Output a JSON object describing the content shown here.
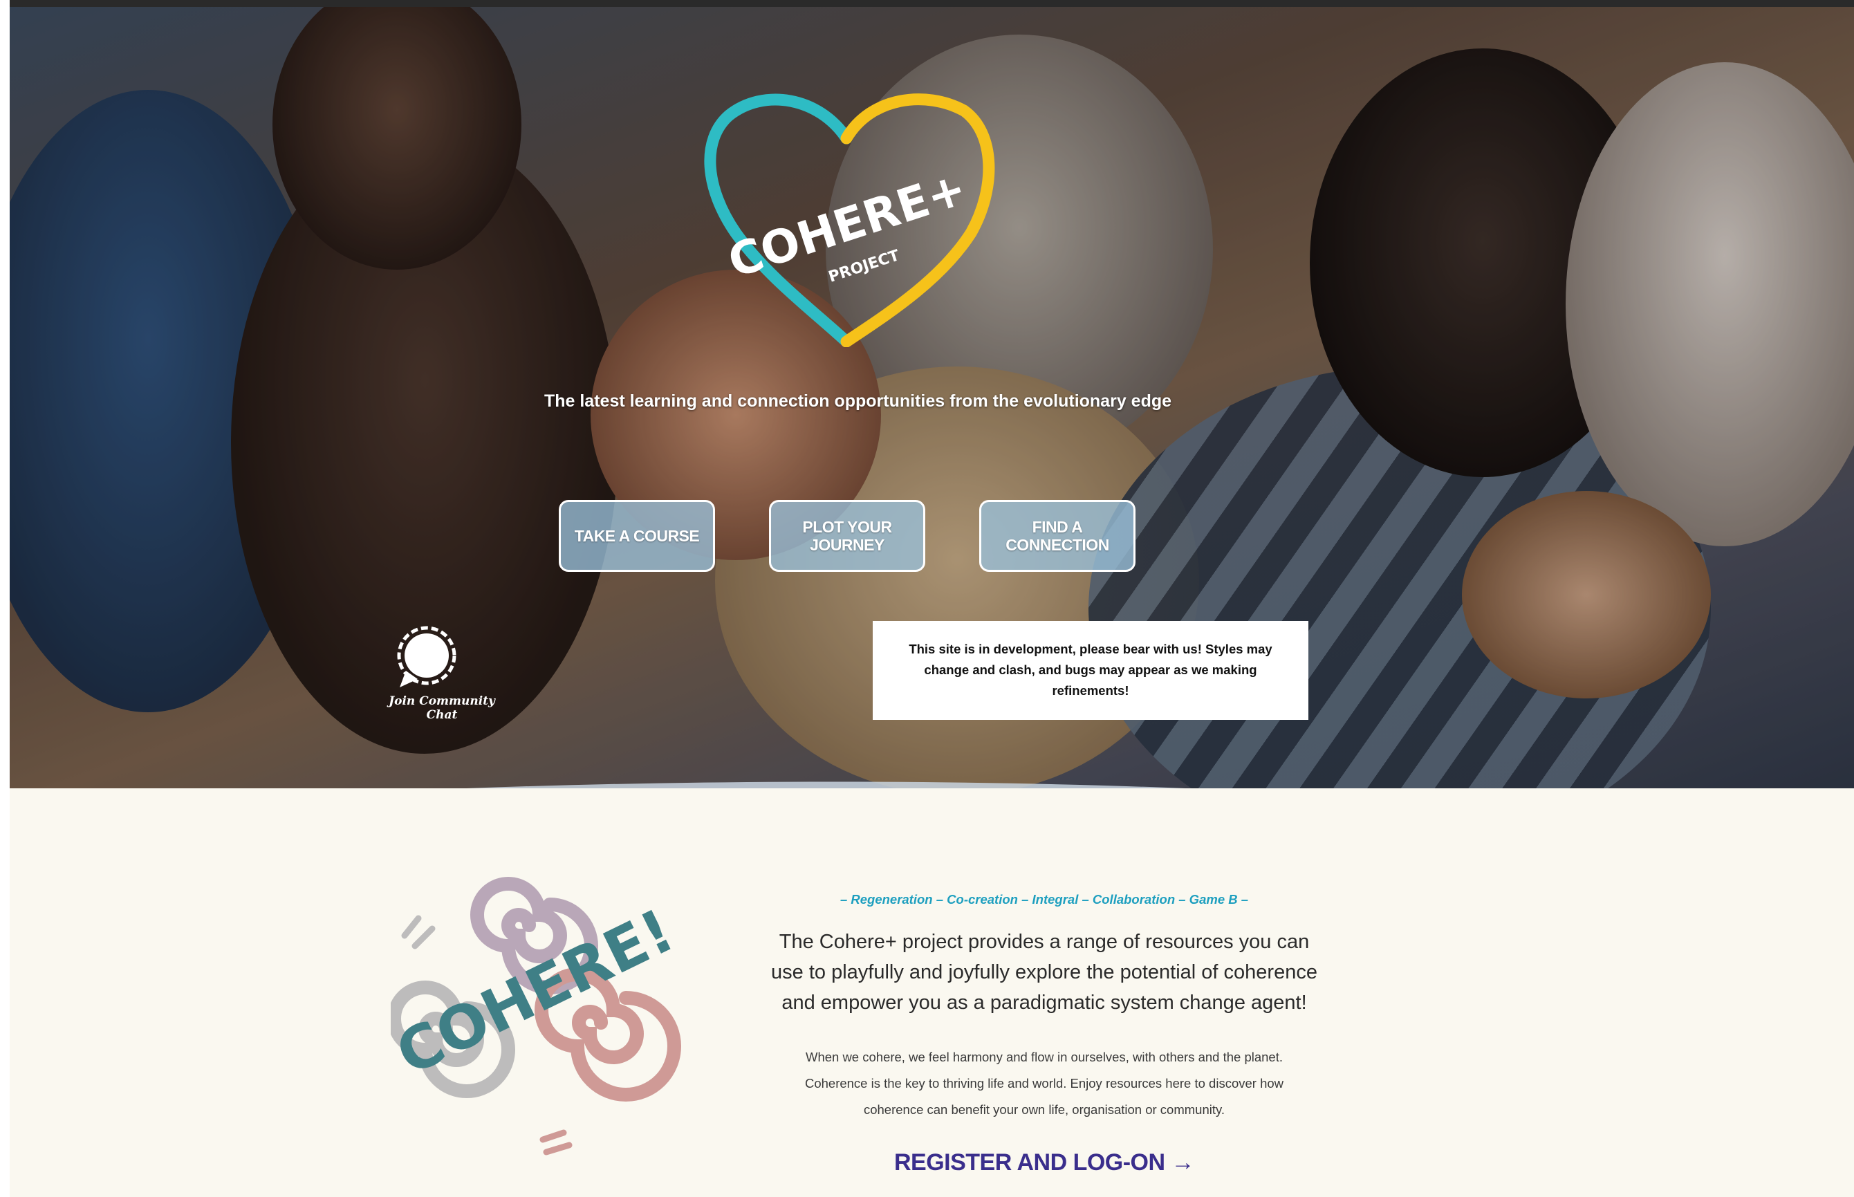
{
  "hero": {
    "logo": {
      "main": "COHERE+",
      "sub": "PROJECT",
      "heart_colors": [
        "#2ebcc4",
        "#f6c21a"
      ]
    },
    "tagline": "The latest learning and connection opportunities from the evolutionary edge",
    "buttons": [
      {
        "label": "TAKE A COURSE"
      },
      {
        "label": "PLOT YOUR JOURNEY"
      },
      {
        "label": "FIND A CONNECTION"
      }
    ],
    "chat": {
      "icon": "speech-bubble-icon",
      "label": "Join Community Chat"
    },
    "notice": "This site is in development, please bear with us!  Styles may change and clash, and bugs may appear as we making refinements!"
  },
  "intro": {
    "swirl_logo": {
      "text": "COHERE!",
      "colors": [
        "#3f7f86",
        "#b9a7b8",
        "#cf9a96",
        "#bdbcbc"
      ]
    },
    "values": "– Regeneration – Co-creation – Integral – Collaboration – Game B –",
    "lead": "The Cohere+ project provides a range of resources you can use to playfully and joyfully explore the potential of coherence and empower you as a paradigmatic system change agent!",
    "body": "When we cohere, we feel harmony and flow in ourselves, with others and the planet.  Coherence is the key to thriving life and world.  Enjoy resources here to discover how coherence can benefit your own life, organisation or community.",
    "register": "REGISTER AND LOG-ON →"
  },
  "colors": {
    "background": "#faf8f0",
    "accent_teal": "#1d9fbf",
    "register_purple": "#3a2e8c",
    "button_fill": "#9ac0da"
  }
}
